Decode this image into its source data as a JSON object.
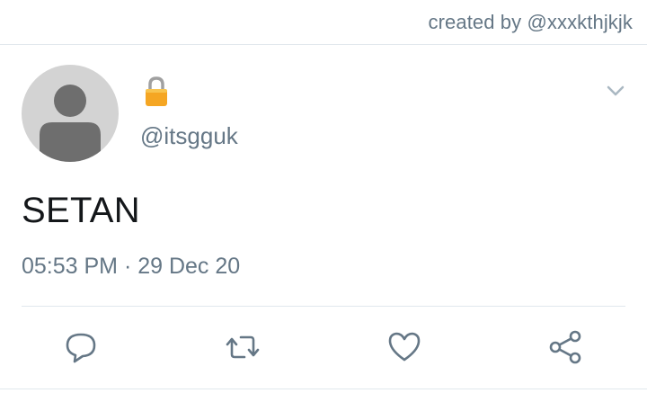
{
  "credit": {
    "text": "created by @xxxkthjkjk"
  },
  "tweet": {
    "protected_icon": "lock-icon",
    "handle": "@itsgguk",
    "text": "SETAN",
    "timestamp": "05:53 PM · 29 Dec 20",
    "menu_icon": "chevron-down-icon"
  },
  "actions": [
    {
      "name": "reply",
      "icon": "comment-icon"
    },
    {
      "name": "retweet",
      "icon": "retweet-icon"
    },
    {
      "name": "like",
      "icon": "heart-icon"
    },
    {
      "name": "share",
      "icon": "share-icon"
    }
  ],
  "colors": {
    "secondary_text": "#657786",
    "primary_text": "#14171a",
    "divider": "#e1e8ed",
    "icon": "#657786",
    "avatar_bg": "#d3d3d3",
    "avatar_figure": "#6e6e6e",
    "lock_body": "#f5a623"
  }
}
